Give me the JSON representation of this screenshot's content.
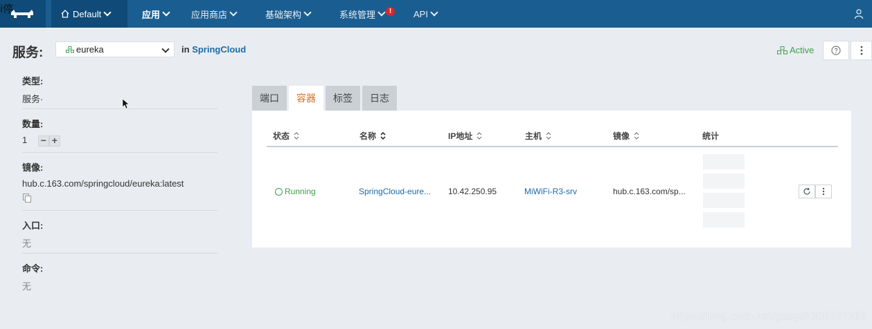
{
  "corner_text": "i停",
  "nav": {
    "env_label": "Default",
    "items": [
      {
        "label": "应用",
        "active": true
      },
      {
        "label": "应用商店",
        "active": false
      },
      {
        "label": "基础架构",
        "active": false
      },
      {
        "label": "系统管理",
        "active": false,
        "alert": "!"
      },
      {
        "label": "API",
        "active": false
      }
    ]
  },
  "header": {
    "title": "服务:",
    "service_value": "eureka",
    "in_label": "in",
    "stack_name": "SpringCloud",
    "state": "Active"
  },
  "info": {
    "type_label": "类型:",
    "type_value": "服务·",
    "scale_label": "数量:",
    "scale_value": "1",
    "image_label": "镜像:",
    "image_value": "hub.c.163.com/springcloud/eureka:latest",
    "entry_label": "入口:",
    "entry_value": "无",
    "command_label": "命令:",
    "command_value": "无"
  },
  "tabs": [
    "端口",
    "容器",
    "标签",
    "日志"
  ],
  "active_tab": 1,
  "table": {
    "headers": [
      "状态",
      "名称",
      "IP地址",
      "主机",
      "镜像",
      "统计"
    ],
    "rows": [
      {
        "state": "Running",
        "name": "SpringCloud-eure...",
        "ip": "10.42.250.95",
        "host": "MiWiFi-R3-srv",
        "image": "hub.c.163.com/sp..."
      }
    ]
  },
  "watermark": "https://blog.csdn.net/gdsgdh308227363",
  "colors": {
    "nav_bg": "#1a5e91",
    "active_green": "#3ca04a",
    "link_blue": "#1b6aa8",
    "tab_active_orange": "#e06c17",
    "alert_red": "#d9272e"
  }
}
